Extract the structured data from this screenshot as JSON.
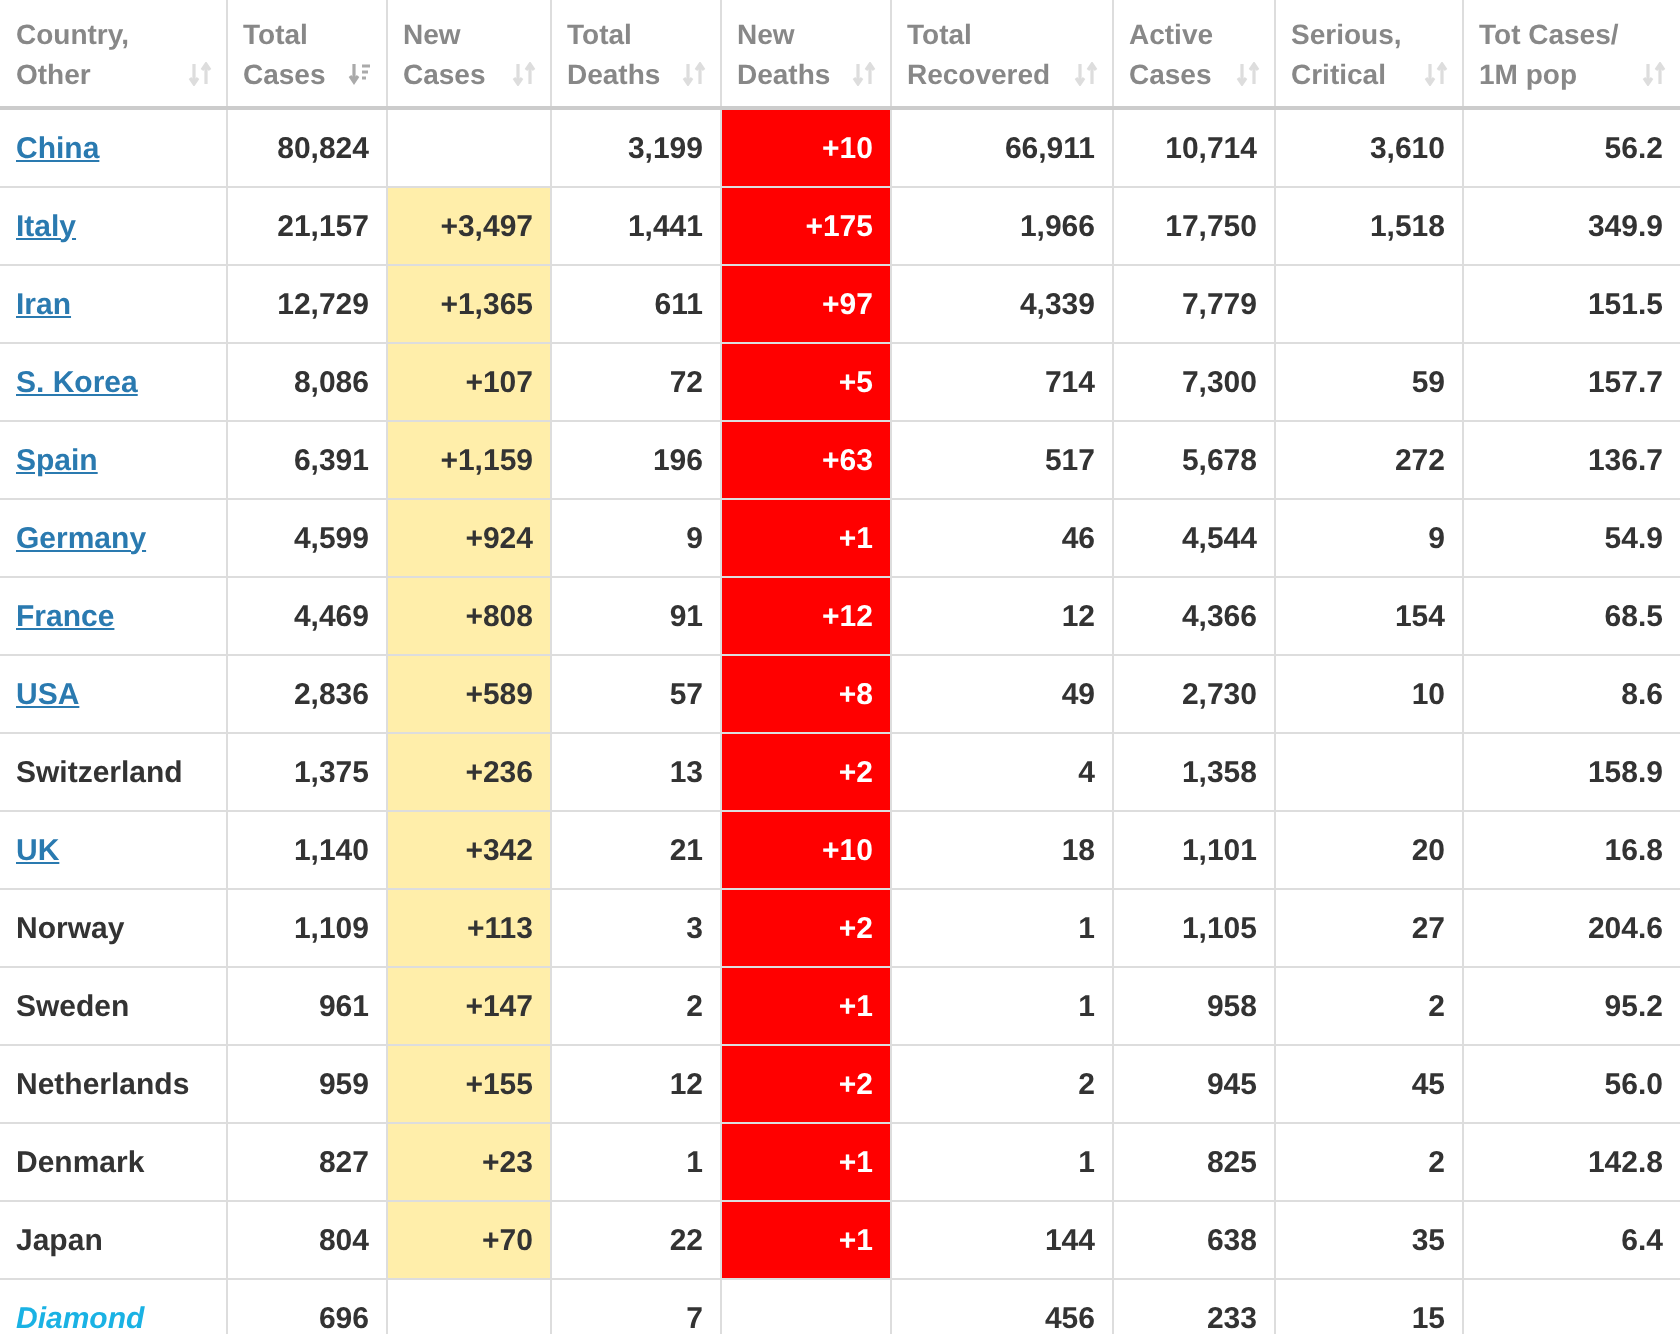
{
  "table": {
    "columns": [
      {
        "label": "Country,",
        "label2": "Other",
        "kind": "country",
        "sorted": false
      },
      {
        "label": "Total",
        "label2": "Cases",
        "kind": "number",
        "sorted": true
      },
      {
        "label": "New",
        "label2": "Cases",
        "kind": "new_cases",
        "sorted": false
      },
      {
        "label": "Total",
        "label2": "Deaths",
        "kind": "number",
        "sorted": false
      },
      {
        "label": "New",
        "label2": "Deaths",
        "kind": "new_deaths",
        "sorted": false
      },
      {
        "label": "Total",
        "label2": "Recovered",
        "kind": "number",
        "sorted": false
      },
      {
        "label": "Active",
        "label2": "Cases",
        "kind": "number",
        "sorted": false
      },
      {
        "label": "Serious,",
        "label2": "Critical",
        "kind": "number",
        "sorted": false
      },
      {
        "label": "Tot Cases/",
        "label2": "1M pop",
        "kind": "number",
        "sorted": false
      }
    ],
    "rows": [
      {
        "kind": "link",
        "cells": [
          "China",
          "80,824",
          null,
          "3,199",
          "+10",
          "66,911",
          "10,714",
          "3,610",
          "56.2"
        ]
      },
      {
        "kind": "link",
        "cells": [
          "Italy",
          "21,157",
          "+3,497",
          "1,441",
          "+175",
          "1,966",
          "17,750",
          "1,518",
          "349.9"
        ]
      },
      {
        "kind": "link",
        "cells": [
          "Iran",
          "12,729",
          "+1,365",
          "611",
          "+97",
          "4,339",
          "7,779",
          null,
          "151.5"
        ]
      },
      {
        "kind": "link",
        "cells": [
          "S. Korea",
          "8,086",
          "+107",
          "72",
          "+5",
          "714",
          "7,300",
          "59",
          "157.7"
        ]
      },
      {
        "kind": "link",
        "cells": [
          "Spain",
          "6,391",
          "+1,159",
          "196",
          "+63",
          "517",
          "5,678",
          "272",
          "136.7"
        ]
      },
      {
        "kind": "link",
        "cells": [
          "Germany",
          "4,599",
          "+924",
          "9",
          "+1",
          "46",
          "4,544",
          "9",
          "54.9"
        ]
      },
      {
        "kind": "link",
        "cells": [
          "France",
          "4,469",
          "+808",
          "91",
          "+12",
          "12",
          "4,366",
          "154",
          "68.5"
        ]
      },
      {
        "kind": "link",
        "cells": [
          "USA",
          "2,836",
          "+589",
          "57",
          "+8",
          "49",
          "2,730",
          "10",
          "8.6"
        ]
      },
      {
        "kind": "plain",
        "cells": [
          "Switzerland",
          "1,375",
          "+236",
          "13",
          "+2",
          "4",
          "1,358",
          null,
          "158.9"
        ]
      },
      {
        "kind": "link",
        "cells": [
          "UK",
          "1,140",
          "+342",
          "21",
          "+10",
          "18",
          "1,101",
          "20",
          "16.8"
        ]
      },
      {
        "kind": "plain",
        "cells": [
          "Norway",
          "1,109",
          "+113",
          "3",
          "+2",
          "1",
          "1,105",
          "27",
          "204.6"
        ]
      },
      {
        "kind": "plain",
        "cells": [
          "Sweden",
          "961",
          "+147",
          "2",
          "+1",
          "1",
          "958",
          "2",
          "95.2"
        ]
      },
      {
        "kind": "plain",
        "cells": [
          "Netherlands",
          "959",
          "+155",
          "12",
          "+2",
          "2",
          "945",
          "45",
          "56.0"
        ]
      },
      {
        "kind": "plain",
        "cells": [
          "Denmark",
          "827",
          "+23",
          "1",
          "+1",
          "1",
          "825",
          "2",
          "142.8"
        ]
      },
      {
        "kind": "plain",
        "cells": [
          "Japan",
          "804",
          "+70",
          "22",
          "+1",
          "144",
          "638",
          "35",
          "6.4"
        ]
      },
      {
        "kind": "ship",
        "cells": [
          "Diamond",
          "696",
          null,
          "7",
          null,
          "456",
          "233",
          "15",
          null
        ]
      }
    ]
  }
}
